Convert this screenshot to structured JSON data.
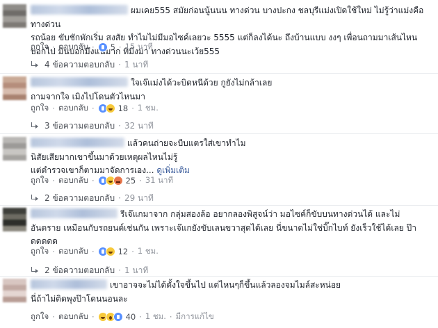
{
  "ui": {
    "like_label": "ถูกใจ",
    "reply_label": "ตอบกลับ",
    "dot": "·"
  },
  "comments": [
    {
      "lines": [
        "ผมเคย555 สมัยก่อนนู้นนน ทางด่วน บางปะกง ชลบุรีแม่งเปิดใช้ใหม่ ไม่รู้ว่าแม่งคือทางด่วน",
        "รถน้อย ขับชักพักเริ่ม สงสัย ทำไมไม่มีมอไซค์เลยวะ 5555 แต่ก็ลงได้นะ ถึงบ้านแบบ งงๆ เพื่อนถามมาเส้นไหน",
        "บอกไป มันบอกมึงแน่มาก ที่มึงมา ทางด่วนนะเว้ย555"
      ],
      "more": "",
      "reaction_count": "5",
      "time": "15 นาที",
      "edited": "",
      "reactions": [
        "like"
      ],
      "replies_text": "4 ข้อความตอบกลับ",
      "replies_time": "1 นาที",
      "avatar_colors": [
        "#8f8c88",
        "#6f6c69",
        "#a09d98",
        "#7e7a75"
      ]
    },
    {
      "lines": [
        "ใจเจ๊แม่งได้วะบิดหนีด้วย กูยังไม่กล้าเลย",
        "ถามจากใจ เมิงไปโดนตัวไหนมา"
      ],
      "more": "",
      "reaction_count": "18",
      "time": "1 ชม.",
      "edited": "",
      "reactions": [
        "like",
        "haha"
      ],
      "replies_text": "3 ข้อความตอบกลับ",
      "replies_time": "32 นาที",
      "avatar_colors": [
        "#c9a996",
        "#b58e7c",
        "#d7bcae",
        "#a98270"
      ]
    },
    {
      "lines": [
        "แล้วคนถ่ายจะบีบแตรใส่เขาทำไม",
        "นิสัยเสียมากเขาขึ้นมาด้วยเหตุผลไหนไม่รู้",
        "แต่ตำรวจเขาก็ตามมาจัดการเอง..."
      ],
      "more": "ดูเพิ่มเติม",
      "reaction_count": "25",
      "time": "31 นาที",
      "edited": "",
      "reactions": [
        "like",
        "haha",
        "angry"
      ],
      "replies_text": "2 ข้อความตอบกลับ",
      "replies_time": "29 นาที",
      "avatar_colors": [
        "#b9b7b4",
        "#9c9a98",
        "#c8c6c3",
        "#a5a3a0"
      ]
    },
    {
      "lines": [
        "รีเจ๊แกมาจาก กลุ่มสองล้อ อยากลองพิสูจน์ว่า มอไซค์ก็ขับบนทางด่วนได้ และไม่",
        "อันตราย เหมือนกับรถยนต์เช่นกัน เพราะเจ๊แกยังขับเลนขวาสุดได้เลย นี่ขนาดไม่ใช่บิ๊กไบท์ ยังเร็วใช้ได้เลย ป๊า",
        "ดดดดด"
      ],
      "more": "",
      "reaction_count": "12",
      "time": "1 ชม.",
      "edited": "",
      "reactions": [
        "like",
        "haha"
      ],
      "replies_text": "2 ข้อความตอบกลับ",
      "replies_time": "1 นาที",
      "avatar_colors": [
        "#3e3f3a",
        "#6d6b62",
        "#2d2e2a",
        "#8a877d"
      ]
    },
    {
      "lines": [
        "เขาอาจจะไม่ได้ตั้งใจขึ้นไป แต่ไหนๆก็ขึ้นแล้วลองจมไมล์สะหน่อย",
        "นี่ถ้าไม่ติดพุงป๊าโดนนอนละ"
      ],
      "more": "",
      "reaction_count": "40",
      "time": "1 ชม.",
      "edited": "มีการแก้ไข",
      "reactions": [
        "haha",
        "wow",
        "like"
      ],
      "replies_text": "",
      "replies_time": "",
      "avatar_colors": [
        "#d8c6c1",
        "#c2aaa3",
        "#e4d6d2",
        "#b89d95"
      ]
    }
  ]
}
